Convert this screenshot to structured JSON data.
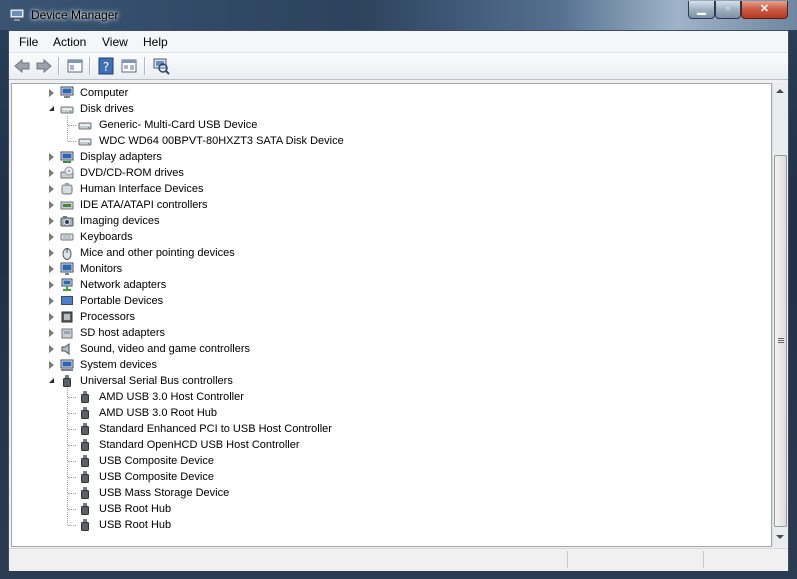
{
  "window": {
    "title": "Device Manager"
  },
  "window_controls": {
    "minimize": "▁",
    "maximize": "▫",
    "close": "✕"
  },
  "menu": [
    {
      "label": "File"
    },
    {
      "label": "Action"
    },
    {
      "label": "View"
    },
    {
      "label": "Help"
    }
  ],
  "toolbar": {
    "buttons": [
      "back-icon",
      "forward-icon",
      "show-hide-console-tree-icon",
      "help-icon",
      "properties-icon",
      "scan-hardware-changes-icon"
    ]
  },
  "tree": {
    "items": [
      {
        "label": "Computer",
        "level": 0,
        "expanded": false,
        "icon": "computer-icon"
      },
      {
        "label": "Disk drives",
        "level": 0,
        "expanded": true,
        "icon": "disk-drive-icon"
      },
      {
        "label": "Generic- Multi-Card USB Device",
        "level": 1,
        "icon": "disk-drive-icon"
      },
      {
        "label": "WDC WD64 00BPVT-80HXZT3 SATA Disk Device",
        "level": 1,
        "icon": "disk-drive-icon"
      },
      {
        "label": "Display adapters",
        "level": 0,
        "expanded": false,
        "icon": "display-adapter-icon"
      },
      {
        "label": "DVD/CD-ROM drives",
        "level": 0,
        "expanded": false,
        "icon": "dvd-drive-icon"
      },
      {
        "label": "Human Interface Devices",
        "level": 0,
        "expanded": false,
        "icon": "hid-icon"
      },
      {
        "label": "IDE ATA/ATAPI controllers",
        "level": 0,
        "expanded": false,
        "icon": "ide-controller-icon"
      },
      {
        "label": "Imaging devices",
        "level": 0,
        "expanded": false,
        "icon": "camera-icon"
      },
      {
        "label": "Keyboards",
        "level": 0,
        "expanded": false,
        "icon": "keyboard-icon"
      },
      {
        "label": "Mice and other pointing devices",
        "level": 0,
        "expanded": false,
        "icon": "mouse-icon"
      },
      {
        "label": "Monitors",
        "level": 0,
        "expanded": false,
        "icon": "monitor-icon"
      },
      {
        "label": "Network adapters",
        "level": 0,
        "expanded": false,
        "icon": "network-adapter-icon"
      },
      {
        "label": "Portable Devices",
        "level": 0,
        "expanded": false,
        "icon": "portable-device-icon"
      },
      {
        "label": "Processors",
        "level": 0,
        "expanded": false,
        "icon": "processor-icon"
      },
      {
        "label": "SD host adapters",
        "level": 0,
        "expanded": false,
        "icon": "sd-adapter-icon"
      },
      {
        "label": "Sound, video and game controllers",
        "level": 0,
        "expanded": false,
        "icon": "speaker-icon"
      },
      {
        "label": "System devices",
        "level": 0,
        "expanded": false,
        "icon": "system-device-icon"
      },
      {
        "label": "Universal Serial Bus controllers",
        "level": 0,
        "expanded": true,
        "icon": "usb-icon"
      },
      {
        "label": "AMD USB 3.0 Host Controller",
        "level": 1,
        "icon": "usb-icon"
      },
      {
        "label": "AMD USB 3.0 Root Hub",
        "level": 1,
        "icon": "usb-icon"
      },
      {
        "label": "Standard Enhanced PCI to USB Host Controller",
        "level": 1,
        "icon": "usb-icon"
      },
      {
        "label": "Standard OpenHCD USB Host Controller",
        "level": 1,
        "icon": "usb-icon"
      },
      {
        "label": "USB Composite Device",
        "level": 1,
        "icon": "usb-icon"
      },
      {
        "label": "USB Composite Device",
        "level": 1,
        "icon": "usb-icon"
      },
      {
        "label": "USB Mass Storage Device",
        "level": 1,
        "icon": "usb-icon"
      },
      {
        "label": "USB Root Hub",
        "level": 1,
        "icon": "usb-icon"
      },
      {
        "label": "USB Root Hub",
        "level": 1,
        "icon": "usb-icon"
      }
    ]
  },
  "colors": {
    "tree_background": "#ffffff",
    "client_background": "#f0f0f0"
  }
}
